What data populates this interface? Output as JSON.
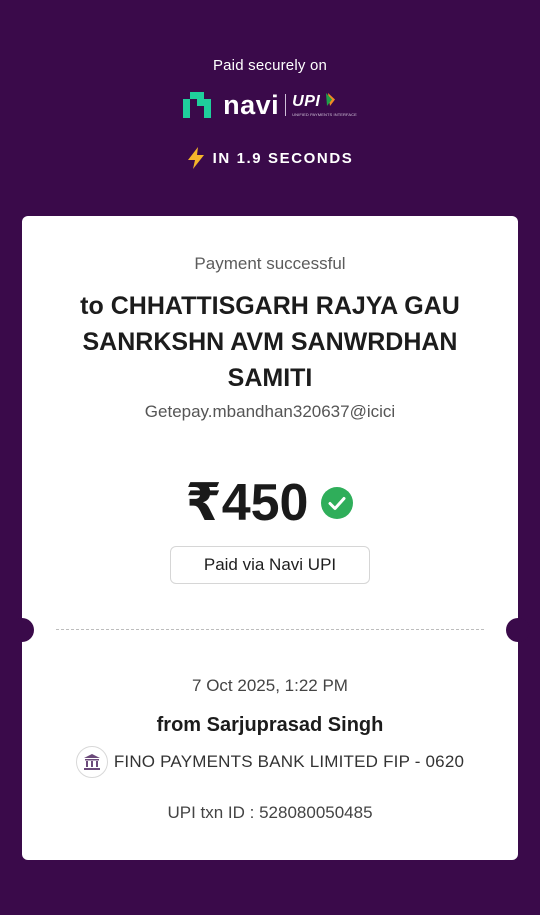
{
  "header": {
    "secure_text": "Paid securely on",
    "brand_name": "navi",
    "upi_label": "UPI",
    "upi_subtitle": "UNIFIED PAYMENTS INTERFACE",
    "speed_text": "IN 1.9 SECONDS"
  },
  "receipt": {
    "status": "Payment successful",
    "payee": "to CHHATTISGARH RAJYA GAU SANRKSHN AVM SANWRDHAN SAMITI",
    "vpa": "Getepay.mbandhan320637@icici",
    "amount": "₹450",
    "paid_via": "Paid via Navi UPI",
    "date": "7 Oct 2025, 1:22 PM",
    "from": "from Sarjuprasad  Singh",
    "bank": "FINO PAYMENTS BANK LIMITED FIP - 0620",
    "txn_id": "UPI txn ID : 528080050485"
  },
  "colors": {
    "background": "#3a0a4a",
    "brand_green": "#1fcf9c",
    "success_green": "#2fae5a",
    "bolt": "#f5b52a"
  },
  "icons": [
    "navi-logo-icon",
    "bolt-icon",
    "check-circle-icon",
    "bank-icon"
  ]
}
